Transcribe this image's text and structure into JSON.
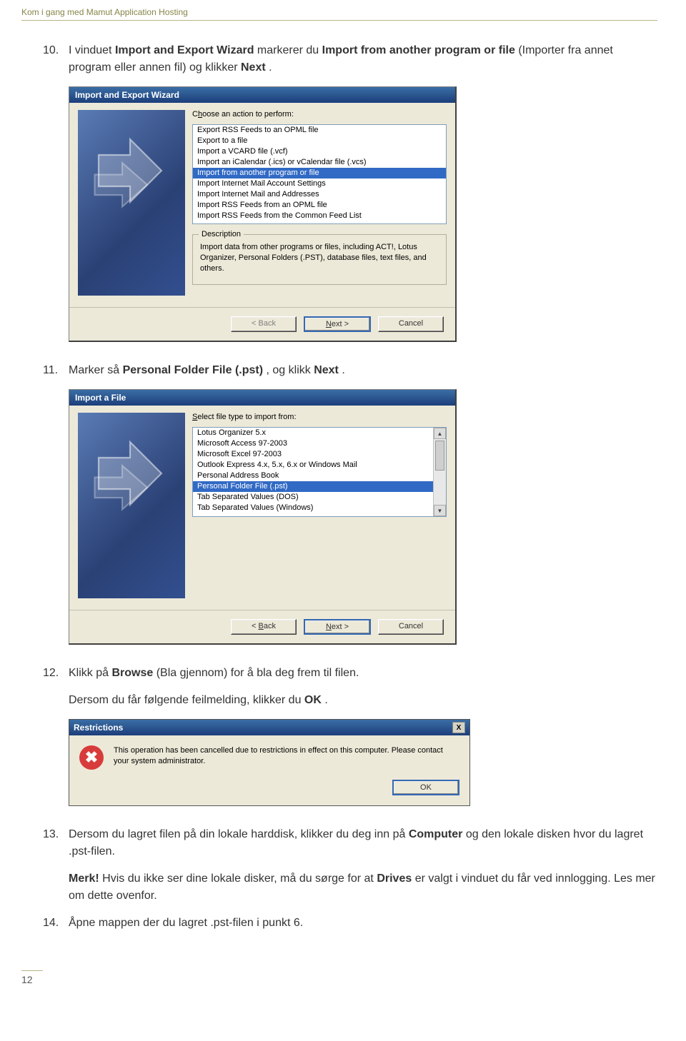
{
  "header": "Kom i gang med Mamut Application Hosting",
  "step10": {
    "num": "10.",
    "t1": "I vinduet ",
    "b1": "Import and Export Wizard",
    "t2": " markerer du ",
    "b2": "Import from another program or file",
    "t3": " (Importer fra annet program eller annen fil) og klikker ",
    "b3": "Next",
    "t4": "."
  },
  "dialog1": {
    "title": "Import and Export Wizard",
    "prompt_pre": "C",
    "prompt_u": "h",
    "prompt_post": "oose an action to perform:",
    "options": [
      "Export RSS Feeds to an OPML file",
      "Export to a file",
      "Import a VCARD file (.vcf)",
      "Import an iCalendar (.ics) or vCalendar file (.vcs)",
      "Import from another program or file",
      "Import Internet Mail Account Settings",
      "Import Internet Mail and Addresses",
      "Import RSS Feeds from an OPML file",
      "Import RSS Feeds from the Common Feed List"
    ],
    "selected_index": 4,
    "desc_legend": "Description",
    "desc_text": "Import data from other programs or files, including ACT!, Lotus Organizer, Personal Folders (.PST), database files, text files, and others.",
    "back": "< Back",
    "next": "Next >",
    "cancel": "Cancel"
  },
  "step11": {
    "num": "11.",
    "t1": "Marker så ",
    "b1": "Personal Folder File (.pst)",
    "t2": ", og klikk ",
    "b2": "Next",
    "t3": "."
  },
  "dialog2": {
    "title": "Import a File",
    "prompt_pre": "",
    "prompt_u": "S",
    "prompt_post": "elect file type to import from:",
    "options": [
      "Lotus Organizer 5.x",
      "Microsoft Access 97-2003",
      "Microsoft Excel 97-2003",
      "Outlook Express 4.x, 5.x, 6.x or Windows Mail",
      "Personal Address Book",
      "Personal Folder File (.pst)",
      "Tab Separated Values (DOS)",
      "Tab Separated Values (Windows)"
    ],
    "selected_index": 5,
    "back": "< Back",
    "next": "Next >",
    "cancel": "Cancel"
  },
  "step12": {
    "num": "12.",
    "t1": "Klikk på ",
    "b1": "Browse",
    "t2": " (Bla gjennom) for å bla deg frem til filen."
  },
  "step12b": {
    "t1": "Dersom du får følgende feilmelding, klikker du ",
    "b1": "OK",
    "t2": "."
  },
  "restrict": {
    "title": "Restrictions",
    "close": "X",
    "msg": "This operation has been cancelled due to restrictions in effect on this computer. Please contact your system administrator.",
    "ok": "OK"
  },
  "step13": {
    "num": "13.",
    "t1": "Dersom du lagret filen på din lokale harddisk, klikker du deg inn på ",
    "b1": "Computer",
    "t2": " og den lokale disken hvor du lagret .pst-filen."
  },
  "merk": {
    "b1": "Merk!",
    "t1": " Hvis du ikke ser dine lokale disker, må du sørge for at ",
    "b2": "Drives",
    "t2": " er valgt i vinduet du får ved innlogging. Les mer om dette ovenfor."
  },
  "step14": {
    "num": "14.",
    "t1": "Åpne mappen der du lagret .pst-filen i punkt 6."
  },
  "page_num": "12"
}
